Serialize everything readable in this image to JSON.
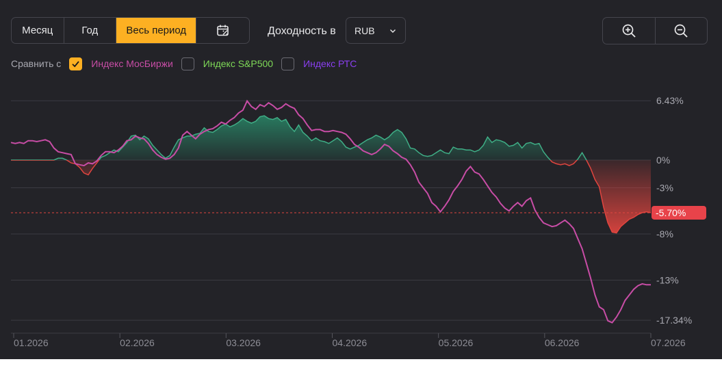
{
  "controls": {
    "periods": [
      "Месяц",
      "Год",
      "Весь период"
    ],
    "active_period": "Весь период",
    "calendar_icon": "calendar-icon",
    "yield_label": "Доходность в",
    "currency_value": "RUB",
    "zoom_in_icon": "zoom-in-icon",
    "zoom_out_icon": "zoom-out-icon"
  },
  "compare": {
    "label": "Сравнить с",
    "items": [
      {
        "label": "Индекс МосБиржи",
        "checked": true,
        "color": "#c84da6"
      },
      {
        "label": "Индекс S&P500",
        "checked": false,
        "color": "#7ed957"
      },
      {
        "label": "Индекс РТС",
        "checked": false,
        "color": "#8a3ff0"
      }
    ]
  },
  "chart_data": {
    "type": "line",
    "ylim": [
      -18.6,
      10.7
    ],
    "y_ticks": [
      6.43,
      0,
      -3,
      -8,
      -13,
      -17.34
    ],
    "y_tick_labels": [
      "6.43%",
      "0%",
      "-3%",
      "-8%",
      "-13%",
      "-17.34%"
    ],
    "x_tick_labels": [
      "01.2026",
      "02.2026",
      "03.2026",
      "04.2026",
      "05.2026",
      "06.2026",
      "07.2026"
    ],
    "current_value": -5.7,
    "current_label": "-5.70%",
    "colors": {
      "positive": "#2a9b74",
      "negative": "#e2453f",
      "index": "#c84da6",
      "badge": "#e8434a"
    },
    "portfolio": {
      "name": "",
      "values": [
        0,
        0,
        0,
        0,
        0,
        0,
        0,
        0,
        0,
        0,
        0,
        0.2,
        0.2,
        0,
        -0.3,
        -0.4,
        -0.8,
        -1.4,
        -1.6,
        -0.9,
        -0.3,
        0.3,
        0.5,
        0.8,
        1.1,
        0.9,
        1.4,
        1.9,
        2.6,
        2.7,
        2.2,
        2.6,
        2.3,
        1.6,
        1.1,
        0.6,
        0.2,
        0.5,
        1.4,
        2.2,
        2.4,
        2.6,
        2.6,
        2.8,
        2.9,
        3.5,
        3.1,
        3.0,
        3.3,
        3.7,
        3.9,
        3.6,
        3.8,
        4.1,
        4.5,
        4.2,
        4.0,
        4.2,
        4.7,
        4.8,
        4.5,
        4.4,
        4.6,
        4.2,
        4.4,
        3.6,
        3.1,
        3.8,
        3.0,
        2.6,
        2.1,
        2.4,
        2.1,
        2.0,
        1.8,
        2.1,
        2.4,
        2.0,
        1.4,
        1.2,
        1.4,
        1.6,
        1.9,
        2.2,
        2.4,
        2.7,
        2.5,
        2.2,
        2.5,
        3.0,
        3.3,
        3.0,
        2.3,
        1.3,
        1.2,
        0.8,
        0.5,
        0.4,
        0.5,
        0.8,
        1.1,
        0.8,
        0.7,
        1.4,
        1.2,
        1.2,
        1.1,
        1.1,
        0.9,
        1.1,
        1.6,
        2.5,
        1.9,
        2.2,
        2.1,
        1.9,
        1.5,
        1.6,
        1.9,
        1.3,
        1.8,
        1.9,
        1.7,
        1.8,
        0.9,
        0.3,
        -0.2,
        -0.4,
        -0.5,
        -0.4,
        -0.6,
        -0.4,
        0.1,
        0.8,
        0,
        -0.9,
        -2.1,
        -2.9,
        -5.1,
        -6.8,
        -7.8,
        -7.9,
        -7.2,
        -6.8,
        -6.4,
        -6.2,
        -5.9,
        -5.7,
        -5.6,
        -5.7
      ]
    },
    "index": {
      "name": "",
      "values": [
        1.9,
        1.8,
        1.9,
        1.8,
        2.1,
        2.1,
        2.0,
        2.1,
        2.2,
        2.0,
        1.3,
        0.9,
        0.8,
        0.7,
        0.6,
        -0.4,
        -0.5,
        -0.6,
        -0.3,
        -0.4,
        -0.1,
        0.5,
        0.9,
        0.9,
        0.8,
        1.1,
        1.5,
        2.1,
        2.2,
        2.6,
        2.4,
        2.3,
        1.8,
        1.1,
        0.6,
        0.3,
        0.1,
        0.2,
        0.6,
        1.3,
        2.7,
        3.1,
        2.7,
        2.3,
        2.8,
        3.1,
        3.3,
        3.4,
        3.7,
        4.1,
        3.9,
        4.3,
        4.6,
        5.1,
        5.4,
        6.4,
        5.8,
        5.5,
        6.0,
        5.8,
        6.2,
        5.9,
        5.5,
        5.7,
        6.1,
        5.8,
        5.6,
        4.9,
        4.5,
        3.8,
        3.2,
        3.3,
        3.3,
        3.1,
        3.1,
        3.2,
        3.1,
        3.0,
        2.8,
        2.3,
        1.7,
        1.4,
        1.0,
        0.8,
        0.6,
        0.8,
        1.2,
        1.7,
        1.5,
        1.0,
        0.7,
        0.3,
        0.1,
        -0.5,
        -1.3,
        -2.4,
        -3.0,
        -3.6,
        -4.6,
        -5.0,
        -5.6,
        -5.0,
        -4.3,
        -3.4,
        -2.8,
        -2.1,
        -1.2,
        -0.7,
        -1.3,
        -1.5,
        -2.1,
        -2.8,
        -3.5,
        -4.0,
        -4.7,
        -5.2,
        -5.5,
        -5.0,
        -4.6,
        -5.0,
        -4.4,
        -4.1,
        -5.4,
        -6.2,
        -6.8,
        -7.0,
        -7.2,
        -7.1,
        -6.8,
        -6.5,
        -6.9,
        -7.4,
        -8.5,
        -9.6,
        -11.2,
        -12.8,
        -14.6,
        -15.9,
        -16.2,
        -17.4,
        -17.6,
        -17.0,
        -16.2,
        -15.2,
        -14.6,
        -14.0,
        -13.6,
        -13.4,
        -13.5,
        -13.5
      ]
    }
  }
}
